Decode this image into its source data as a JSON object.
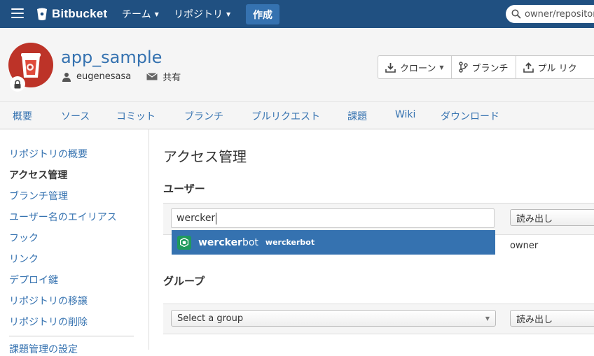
{
  "topbar": {
    "brand": "Bitbucket",
    "menu_team": "チーム",
    "menu_repository": "リポジトリ",
    "create_label": "作成",
    "search_placeholder": "owner/repository"
  },
  "repo": {
    "name": "app_sample",
    "owner": "eugenesasa",
    "share_label": "共有"
  },
  "actions": {
    "clone": "クローン",
    "branch": "ブランチ",
    "pull_request": "プル リク"
  },
  "tabs": [
    "概要",
    "ソース",
    "コミット",
    "ブランチ",
    "プルリクエスト",
    "課題",
    "Wiki",
    "ダウンロード"
  ],
  "sidebar": {
    "items": [
      {
        "label": "リポジトリの概要",
        "active": false
      },
      {
        "label": "アクセス管理",
        "active": true
      },
      {
        "label": "ブランチ管理",
        "active": false
      },
      {
        "label": "ユーザー名のエイリアス",
        "active": false
      },
      {
        "label": "フック",
        "active": false
      },
      {
        "label": "リンク",
        "active": false
      },
      {
        "label": "デプロイ鍵",
        "active": false
      },
      {
        "label": "リポジトリの移譲",
        "active": false
      },
      {
        "label": "リポジトリの削除",
        "active": false
      }
    ],
    "partial_item": "課題管理の設定"
  },
  "main": {
    "title": "アクセス管理",
    "users_heading": "ユーザー",
    "user_input_value": "wercker",
    "user_permission": "読み出し",
    "suggestion": {
      "name_bold": "wercker",
      "name_rest": "bot",
      "username": "werckerbot"
    },
    "owner_label": "owner",
    "groups_heading": "グループ",
    "group_placeholder": "Select a group",
    "group_permission": "読み出し"
  },
  "colors": {
    "topbar": "#205081",
    "accent": "#3572b0",
    "avatar": "#bd3328",
    "suggestion_icon": "#1f9a5c"
  }
}
